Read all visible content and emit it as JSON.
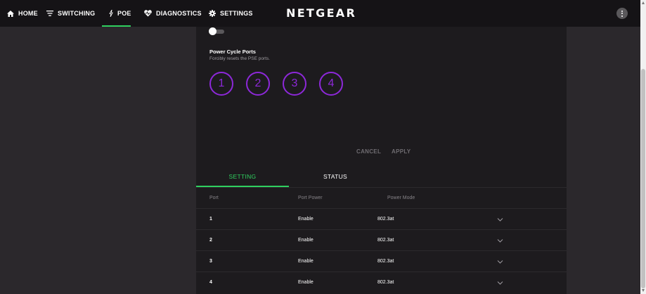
{
  "nav": {
    "items": [
      {
        "label": "HOME",
        "icon": "home-icon"
      },
      {
        "label": "SWITCHING",
        "icon": "switching-icon"
      },
      {
        "label": "POE",
        "icon": "lightning-icon",
        "active": true
      },
      {
        "label": "DIAGNOSTICS",
        "icon": "heart-pulse-icon"
      },
      {
        "label": "SETTINGS",
        "icon": "gear-icon"
      }
    ],
    "logo": "NETGEAR",
    "more_icon": "kebab-menu-icon"
  },
  "power_cycle": {
    "title": "Power Cycle Ports",
    "description": "Forcibly resets the PSE ports.",
    "ports": [
      "1",
      "2",
      "3",
      "4"
    ]
  },
  "actions": {
    "cancel": "CANCEL",
    "apply": "APPLY"
  },
  "tabs": [
    {
      "label": "SETTING",
      "active": true
    },
    {
      "label": "STATUS",
      "active": false
    }
  ],
  "table": {
    "headers": [
      "Port",
      "Port Power",
      "Power Mode"
    ],
    "rows": [
      {
        "port": "1",
        "power": "Enable",
        "mode": "802.3at"
      },
      {
        "port": "2",
        "power": "Enable",
        "mode": "802.3at"
      },
      {
        "port": "3",
        "power": "Enable",
        "mode": "802.3at"
      },
      {
        "port": "4",
        "power": "Enable",
        "mode": "802.3at"
      }
    ]
  },
  "colors": {
    "accent_green": "#2fd05f",
    "accent_purple": "#8d28d9",
    "topbar": "#151316",
    "panel": "#1d1b1e",
    "background": "#2b282c"
  }
}
